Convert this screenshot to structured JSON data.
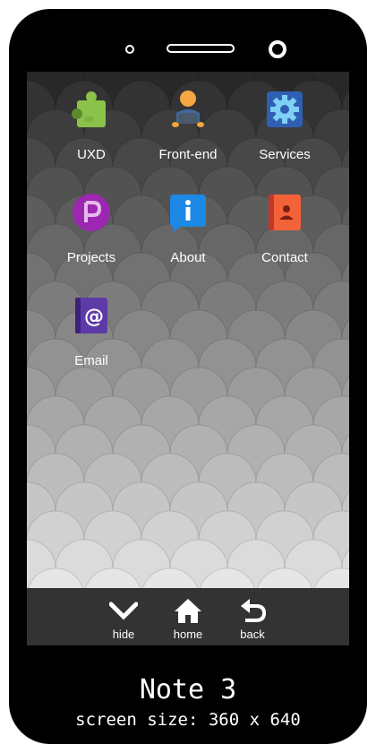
{
  "apps": [
    {
      "id": "uxd",
      "label": "UXD",
      "icon": "puzzle-icon",
      "color": "#8bc34a"
    },
    {
      "id": "frontend",
      "label": "Front-end",
      "icon": "developer-icon",
      "color": "#f4a742"
    },
    {
      "id": "services",
      "label": "Services",
      "icon": "gear-icon",
      "color": "#2f5fb3"
    },
    {
      "id": "projects",
      "label": "Projects",
      "icon": "letter-p-icon",
      "color": "#9c27b0"
    },
    {
      "id": "about",
      "label": "About",
      "icon": "info-icon",
      "color": "#1e88e5"
    },
    {
      "id": "contact",
      "label": "Contact",
      "icon": "contact-book-icon",
      "color": "#f4623a"
    },
    {
      "id": "email",
      "label": "Email",
      "icon": "email-at-icon",
      "color": "#5e3aa8"
    }
  ],
  "nav": {
    "hide_label": "hide",
    "home_label": "home",
    "back_label": "back"
  },
  "device": {
    "name": "Note 3",
    "screen_size": "screen size: 360 x 640"
  }
}
